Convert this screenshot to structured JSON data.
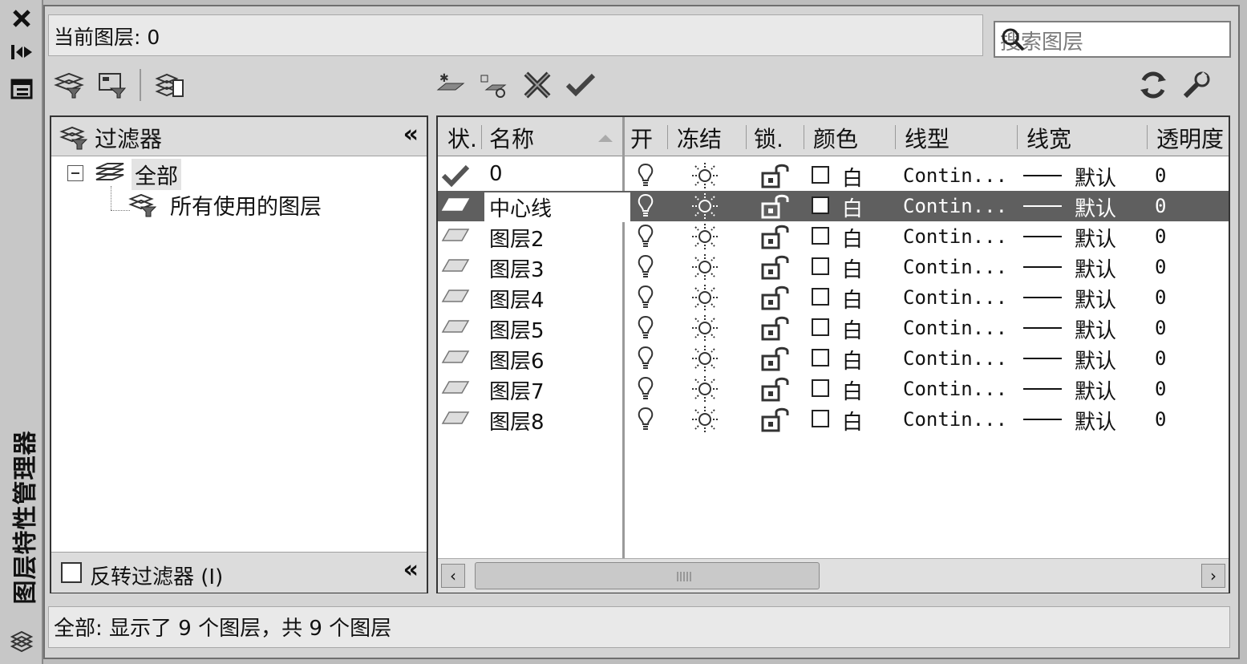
{
  "palette": {
    "title": "图层特性管理器",
    "close_icon": "close-icon",
    "autohide_icon": "autohide-icon",
    "properties_icon": "properties-icon"
  },
  "current_layer": "当前图层: 0",
  "search": {
    "placeholder": "搜索图层"
  },
  "filters": {
    "header": "过滤器",
    "tree": [
      {
        "label": "全部"
      },
      {
        "label": "所有使用的图层"
      }
    ],
    "invert_label": "反转过滤器 (I)"
  },
  "columns": [
    "状.",
    "名称",
    "开",
    "冻结",
    "锁.",
    "颜色",
    "线型",
    "线宽",
    "透明度"
  ],
  "layers": [
    {
      "name": "0",
      "color": "白",
      "linetype": "Contin...",
      "lineweight": "默认",
      "transparency": "0",
      "current": true,
      "selected": false
    },
    {
      "name": "中心线",
      "color": "白",
      "linetype": "Contin...",
      "lineweight": "默认",
      "transparency": "0",
      "current": false,
      "selected": true
    },
    {
      "name": "图层2",
      "color": "白",
      "linetype": "Contin...",
      "lineweight": "默认",
      "transparency": "0",
      "current": false,
      "selected": false
    },
    {
      "name": "图层3",
      "color": "白",
      "linetype": "Contin...",
      "lineweight": "默认",
      "transparency": "0",
      "current": false,
      "selected": false
    },
    {
      "name": "图层4",
      "color": "白",
      "linetype": "Contin...",
      "lineweight": "默认",
      "transparency": "0",
      "current": false,
      "selected": false
    },
    {
      "name": "图层5",
      "color": "白",
      "linetype": "Contin...",
      "lineweight": "默认",
      "transparency": "0",
      "current": false,
      "selected": false
    },
    {
      "name": "图层6",
      "color": "白",
      "linetype": "Contin...",
      "lineweight": "默认",
      "transparency": "0",
      "current": false,
      "selected": false
    },
    {
      "name": "图层7",
      "color": "白",
      "linetype": "Contin...",
      "lineweight": "默认",
      "transparency": "0",
      "current": false,
      "selected": false
    },
    {
      "name": "图层8",
      "color": "白",
      "linetype": "Contin...",
      "lineweight": "默认",
      "transparency": "0",
      "current": false,
      "selected": false
    }
  ],
  "status": "全部: 显示了 9 个图层，共 9 个图层",
  "colors": {
    "selected_row": "#5f5f5f",
    "panel": "#d4d4d4"
  }
}
